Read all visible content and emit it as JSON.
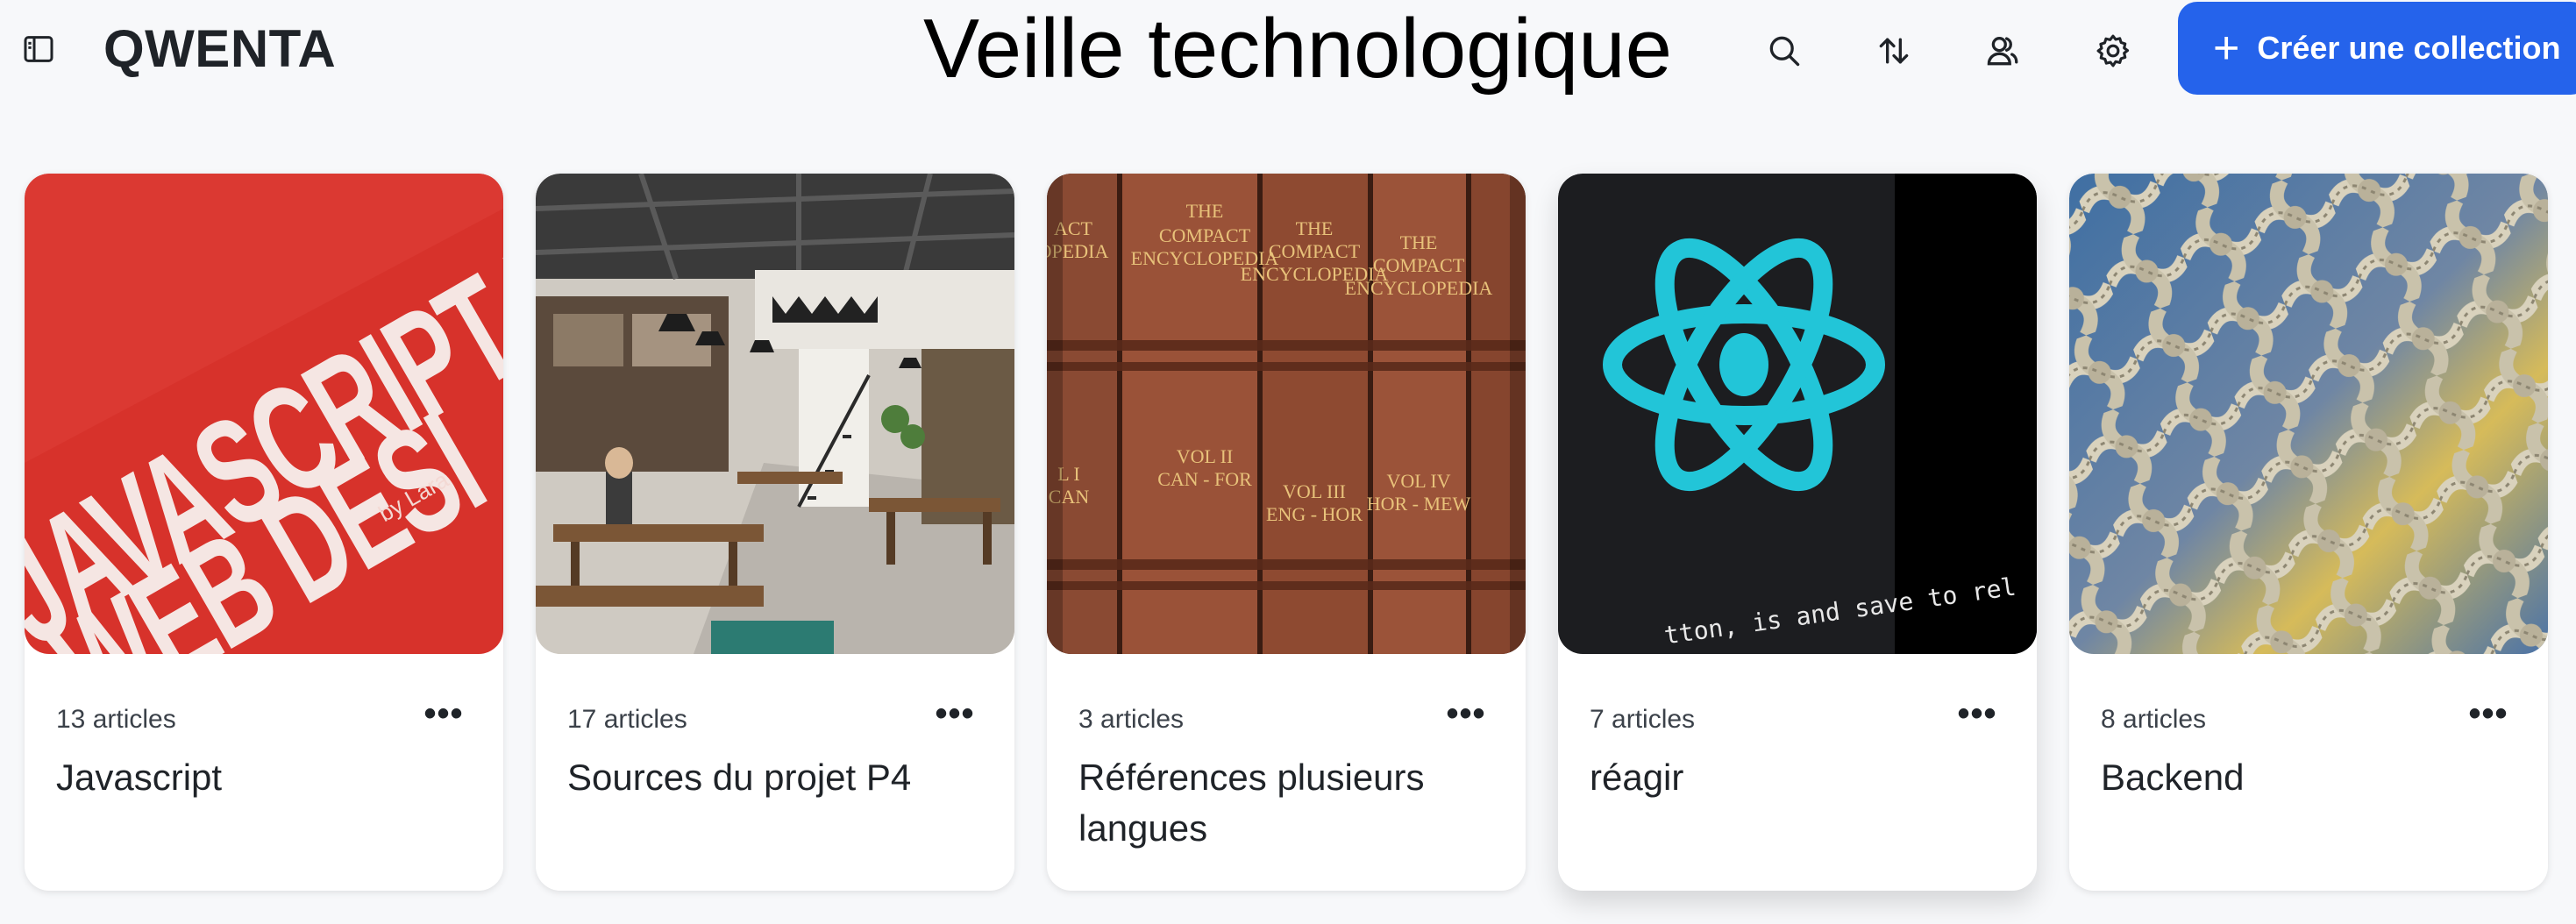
{
  "header": {
    "brand": "QWENTA",
    "title": "Veille technologique",
    "create_button_label": "Créer une collection",
    "icons": [
      "sidebar-icon",
      "search-icon",
      "sort-icon",
      "share-users-icon",
      "gear-icon",
      "plus-icon"
    ]
  },
  "collections": [
    {
      "count": "13 articles",
      "name": "Javascript",
      "more": "•••",
      "image": "red book cover with JAVASCRIPT FOR WEB DESIGN text"
    },
    {
      "count": "17 articles",
      "name": "Sources du projet P4",
      "more": "•••",
      "image": "industrial cafe interior"
    },
    {
      "count": "3 articles",
      "name": "Références plusieurs langues",
      "more": "•••",
      "image": "leather encyclopedia spines"
    },
    {
      "count": "7 articles",
      "name": "réagir",
      "more": "•••",
      "image": "react atom logo on dark screen"
    },
    {
      "count": "8 articles",
      "name": "Backend",
      "more": "•••",
      "image": "knotted rope net"
    }
  ],
  "colors": {
    "accent": "#2563eb",
    "background": "#f7f8fa",
    "card": "#ffffff",
    "react_cyan": "#22c5d8"
  }
}
